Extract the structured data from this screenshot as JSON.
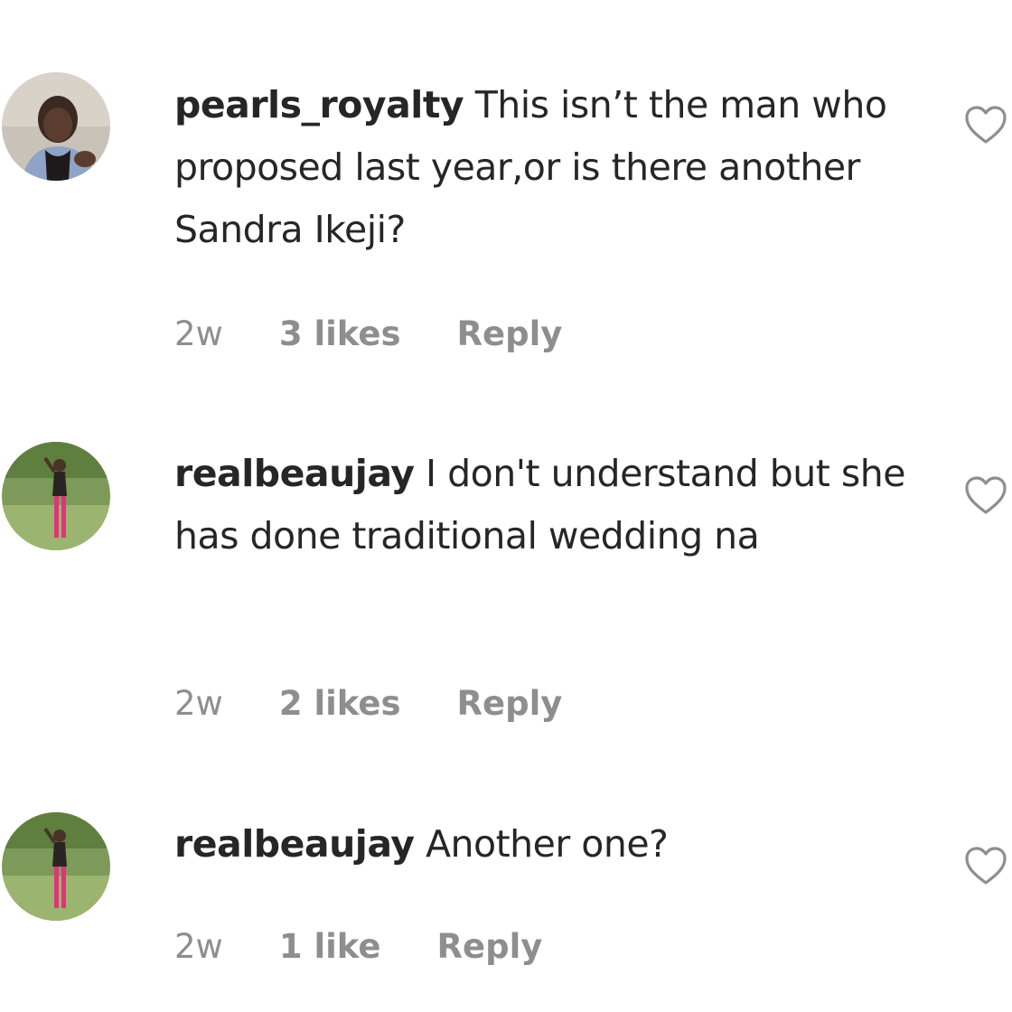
{
  "comments": [
    {
      "username": "pearls_royalty",
      "text": " This isn’t the man who proposed last year,or is there another Sandra Ikeji?",
      "time": "2w",
      "likes": "3 likes",
      "reply_label": "Reply",
      "avatar_icon": "user-avatar-woman-portrait"
    },
    {
      "username": "realbeaujay",
      "text": " I don't understand but she has done traditional wedding na",
      "time": "2w",
      "likes": "2 likes",
      "reply_label": "Reply",
      "avatar_icon": "user-avatar-outdoor-photo"
    },
    {
      "username": "realbeaujay",
      "text": " Another one?",
      "time": "2w",
      "likes": "1 like",
      "reply_label": "Reply",
      "avatar_icon": "user-avatar-outdoor-photo"
    }
  ],
  "colors": {
    "text": "#262626",
    "meta": "#8e8e8e",
    "heart_outline": "#8e8e8e"
  },
  "icons": {
    "like": "heart-outline-icon"
  }
}
